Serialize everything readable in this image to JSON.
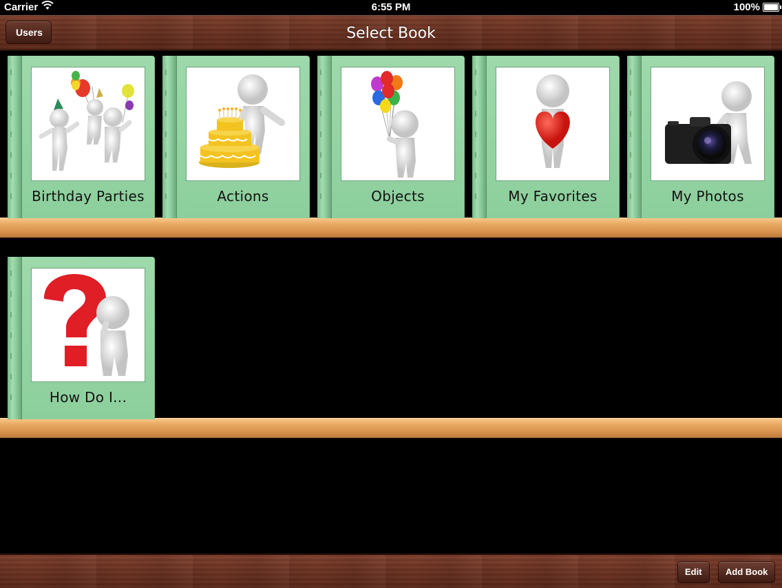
{
  "status_bar": {
    "carrier": "Carrier",
    "time": "6:55 PM",
    "battery": "100%"
  },
  "nav": {
    "back_label": "Users",
    "title": "Select Book"
  },
  "books": [
    {
      "title": "Birthday Parties",
      "icon": "birthday-party-illustration"
    },
    {
      "title": "Actions",
      "icon": "cake-illustration"
    },
    {
      "title": "Objects",
      "icon": "balloons-illustration"
    },
    {
      "title": "My Favorites",
      "icon": "heart-illustration"
    },
    {
      "title": "My Photos",
      "icon": "camera-illustration"
    },
    {
      "title": "How Do I...",
      "icon": "question-mark-illustration"
    }
  ],
  "toolbar": {
    "edit_label": "Edit",
    "add_book_label": "Add Book"
  },
  "colors": {
    "book_green": "#9ed9ab",
    "shelf": "#e9aa64",
    "wood": "#6b3221"
  }
}
